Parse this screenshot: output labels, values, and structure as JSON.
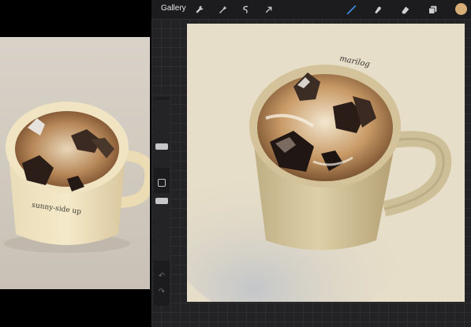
{
  "toolbar": {
    "gallery_label": "Gallery",
    "left_tools": [
      {
        "icon": "wrench-icon"
      },
      {
        "icon": "magic-wand-icon"
      },
      {
        "icon": "selection-icon"
      },
      {
        "icon": "transform-arrow-icon"
      }
    ],
    "right_tools": [
      {
        "icon": "brush-icon",
        "active": true
      },
      {
        "icon": "smudge-icon"
      },
      {
        "icon": "eraser-icon"
      },
      {
        "icon": "layers-icon"
      }
    ],
    "current_color": "#d8ae78",
    "active_color": "#3d8be8"
  },
  "sidebar": {
    "brush_size_icon": "slider-thumb",
    "opacity_icon": "slider-thumb",
    "modify_icon": "square-modify-icon",
    "undo_icon": "undo-arrow-icon",
    "redo_icon": "redo-arrow-icon"
  },
  "canvas": {
    "signature": "marilog"
  },
  "reference_photo": {
    "mug_text_line1": "sunny-side up",
    "description_lines": [
      "•••••••••",
      "•••••••",
      "••••••••",
      "••••••"
    ],
    "bottom_line": "••••• ••••• •••••",
    "badge": "•••••"
  }
}
